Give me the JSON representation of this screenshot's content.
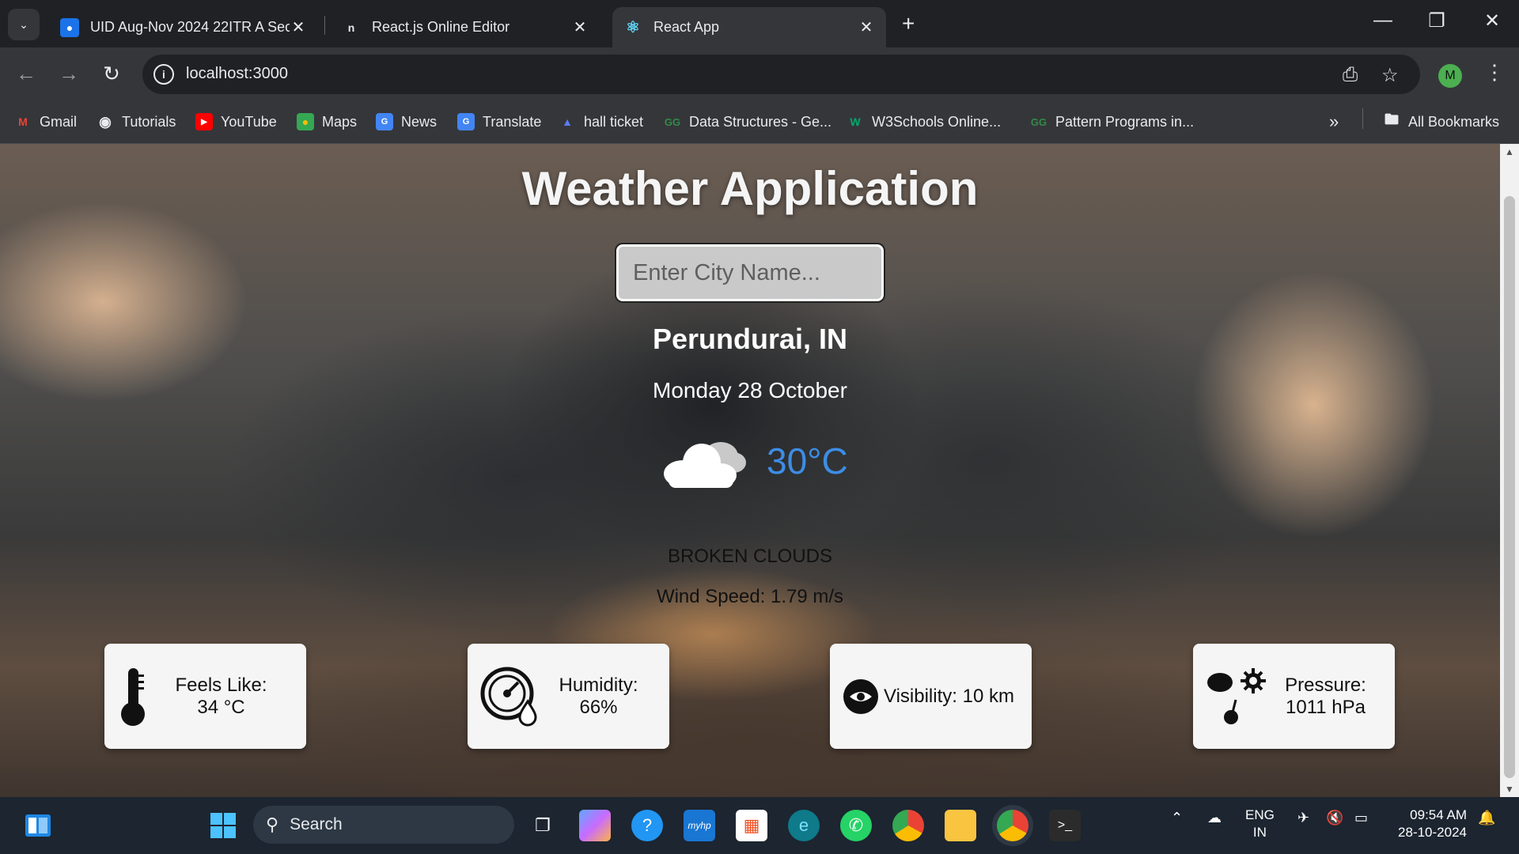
{
  "browser": {
    "tabs": [
      {
        "title": "UID Aug-Nov 2024 22ITR A Sec",
        "active": false
      },
      {
        "title": "React.js Online Editor",
        "active": false
      },
      {
        "title": "React App",
        "active": true
      }
    ],
    "url": "localhost:3000",
    "profile_initial": "M",
    "bookmarks": [
      {
        "label": "Gmail",
        "icon": "gmail-icon"
      },
      {
        "label": "Tutorials",
        "icon": "globe-icon"
      },
      {
        "label": "YouTube",
        "icon": "youtube-icon"
      },
      {
        "label": "Maps",
        "icon": "maps-icon"
      },
      {
        "label": "News",
        "icon": "news-icon"
      },
      {
        "label": "Translate",
        "icon": "translate-icon"
      },
      {
        "label": "hall ticket",
        "icon": "hall-ticket-icon"
      },
      {
        "label": "Data Structures - Ge...",
        "icon": "gfg-icon"
      },
      {
        "label": "W3Schools Online...",
        "icon": "w3schools-icon"
      },
      {
        "label": "Pattern Programs in...",
        "icon": "gfg-icon"
      }
    ],
    "all_bookmarks": "All Bookmarks"
  },
  "app": {
    "title": "Weather Application",
    "search_placeholder": "Enter City Name...",
    "city": "Perundurai, IN",
    "date": "Monday 28 October",
    "temperature": "30°C",
    "description": "BROKEN CLOUDS",
    "wind": "Wind Speed: 1.79 m/s",
    "cards": {
      "feels_like": {
        "label": "Feels Like:",
        "value": "34 °C",
        "icon": "thermometer-icon"
      },
      "humidity": {
        "label": "Humidity:",
        "value": "66%",
        "icon": "humidity-gauge-icon"
      },
      "visibility": {
        "label": "Visibility: 10 km",
        "icon": "eye-icon"
      },
      "pressure": {
        "label": "Pressure:",
        "value": "1011 hPa",
        "icon": "weather-pressure-icon"
      }
    },
    "colors": {
      "temperature": "#3d8de6"
    }
  },
  "taskbar": {
    "search_label": "Search",
    "lang": "ENG",
    "region": "IN",
    "time": "09:54 AM",
    "date": "28-10-2024"
  }
}
